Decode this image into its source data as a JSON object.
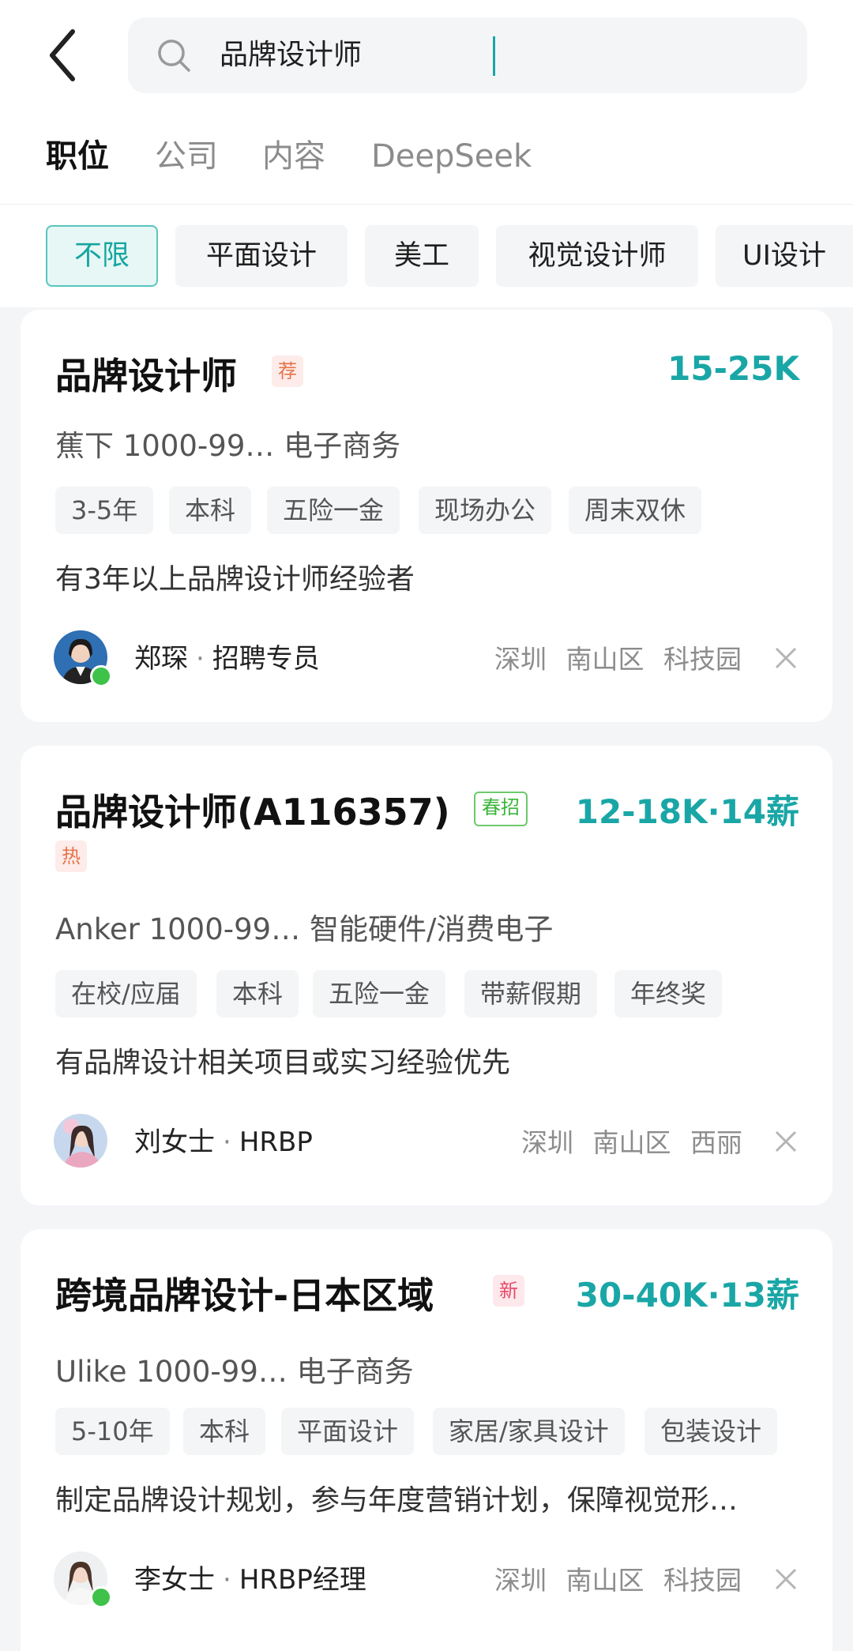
{
  "search": {
    "query": "品牌设计师"
  },
  "tabs": [
    {
      "label": "职位"
    },
    {
      "label": "公司"
    },
    {
      "label": "内容"
    },
    {
      "label": "DeepSeek"
    }
  ],
  "filters": [
    {
      "label": "不限"
    },
    {
      "label": "平面设计"
    },
    {
      "label": "美工"
    },
    {
      "label": "视觉设计师"
    },
    {
      "label": "UI设计"
    }
  ],
  "jobs": [
    {
      "title": "品牌设计师",
      "badge": "荐",
      "salary": "15-25K",
      "company": "蕉下  1000-99…  电子商务",
      "tags": [
        "3-5年",
        "本科",
        "五险一金",
        "现场办公",
        "周末双休"
      ],
      "description": "有3年以上品牌设计师经验者",
      "recruiter_name": "郑琛",
      "recruiter_role": "招聘专员",
      "location": "深圳 南山区 科技园"
    },
    {
      "title": "品牌设计师(A116357)",
      "badge": "春招",
      "badge2": "热",
      "salary": "12-18K·14薪",
      "company": "Anker  1000-99…  智能硬件/消费电子",
      "tags": [
        "在校/应届",
        "本科",
        "五险一金",
        "带薪假期",
        "年终奖"
      ],
      "description": "有品牌设计相关项目或实习经验优先",
      "recruiter_name": "刘女士",
      "recruiter_role": "HRBP",
      "location": "深圳 南山区 西丽"
    },
    {
      "title": "跨境品牌设计-日本区域",
      "badge": "新",
      "salary": "30-40K·13薪",
      "company": "Ulike  1000-99…  电子商务",
      "tags": [
        "5-10年",
        "本科",
        "平面设计",
        "家居/家具设计",
        "包装设计"
      ],
      "description": "制定品牌设计规划，参与年度营销计划，保障视觉形…",
      "recruiter_name": "李女士",
      "recruiter_role": "HRBP经理",
      "location": "深圳 南山区 科技园"
    }
  ],
  "colors": {
    "accent": "#1aa6a6",
    "online": "#3fc24a",
    "background": "#f4f5f7"
  },
  "icons": [
    "back-arrow-icon",
    "search-icon",
    "close-icon"
  ]
}
